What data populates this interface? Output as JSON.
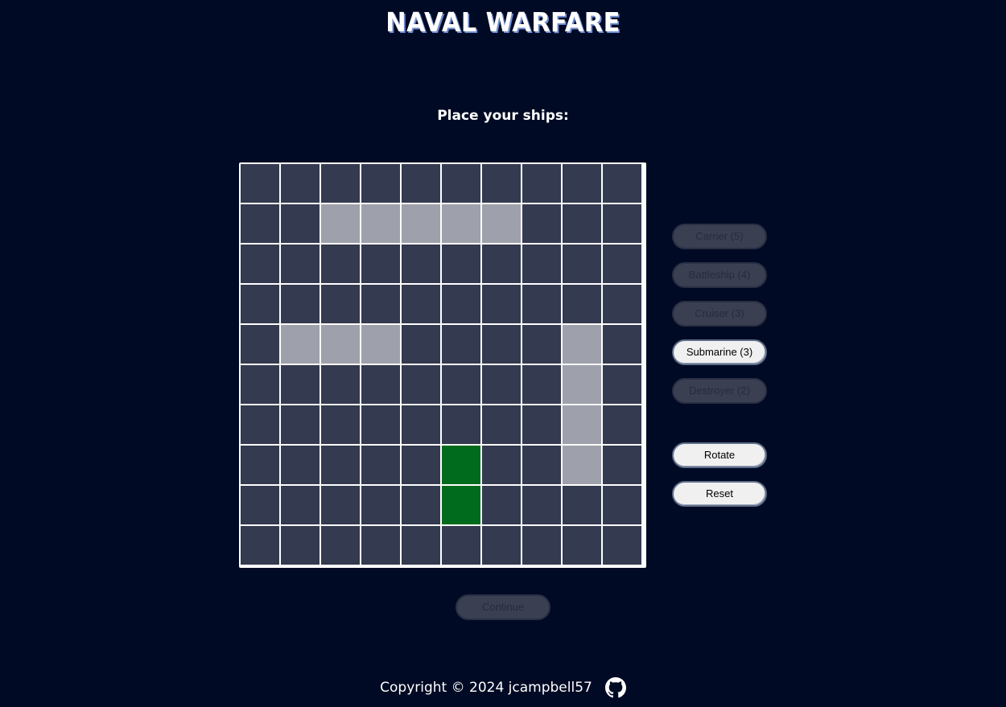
{
  "header": {
    "title": "NAVAL WARFARE"
  },
  "prompt": "Place your ships:",
  "board": {
    "rows": 10,
    "cols": 10,
    "cells": [
      "..........",
      "..SSSSS...",
      "..........",
      "..........",
      ".SSS....S.",
      "........S.",
      "........S.",
      ".....P..S.",
      ".....P....",
      ".........."
    ],
    "legend": {
      ".": "empty",
      "S": "placed-ship",
      "P": "placement-preview"
    }
  },
  "ships": [
    {
      "label": "Carrier (5)",
      "state": "placed"
    },
    {
      "label": "Battleship (4)",
      "state": "placed"
    },
    {
      "label": "Cruiser (3)",
      "state": "placed"
    },
    {
      "label": "Submarine (3)",
      "state": "selected"
    },
    {
      "label": "Destroyer (2)",
      "state": "placed"
    }
  ],
  "controls": {
    "rotate_label": "Rotate",
    "reset_label": "Reset",
    "continue_label": "Continue"
  },
  "footer": {
    "copyright": "Copyright © 2024 jcampbell57",
    "icon": "github-icon"
  },
  "colors": {
    "background": "#000a24",
    "cell_empty": "#343a4f",
    "cell_ship": "#9ea0ab",
    "cell_preview": "#006b1c",
    "grid_line": "#ffffff"
  }
}
